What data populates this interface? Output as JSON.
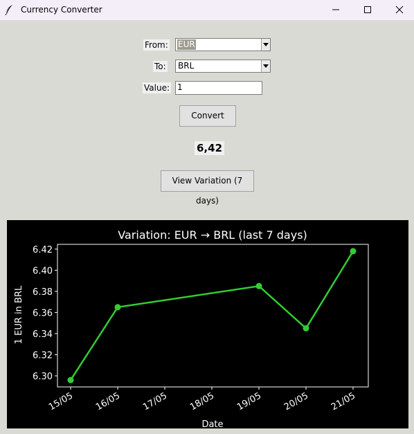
{
  "window": {
    "title": "Currency Converter"
  },
  "form": {
    "from_label": "From:",
    "from_value": "EUR",
    "to_label": "To:",
    "to_value": "BRL",
    "value_label": "Value:",
    "value": "1"
  },
  "convert_label": "Convert",
  "result": "6,42",
  "variation_label": "View Variation (7 days)",
  "colors": {
    "line": "#33cc33",
    "chart_background": "#000000"
  },
  "chart_data": {
    "type": "line",
    "title": "Variation: EUR → BRL (last 7 days)",
    "xlabel": "Date",
    "ylabel": "1 EUR in BRL",
    "x": [
      "15/05",
      "16/05",
      "19/05",
      "20/05",
      "21/05"
    ],
    "y": [
      6.296,
      6.365,
      6.385,
      6.345,
      6.418
    ],
    "xticks": [
      "15/05",
      "16/05",
      "17/05",
      "18/05",
      "19/05",
      "20/05",
      "21/05"
    ],
    "yticks": [
      "6.30",
      "6.32",
      "6.34",
      "6.36",
      "6.38",
      "6.40",
      "6.42"
    ],
    "ylim": [
      6.2895,
      6.4245
    ],
    "grid": false
  }
}
